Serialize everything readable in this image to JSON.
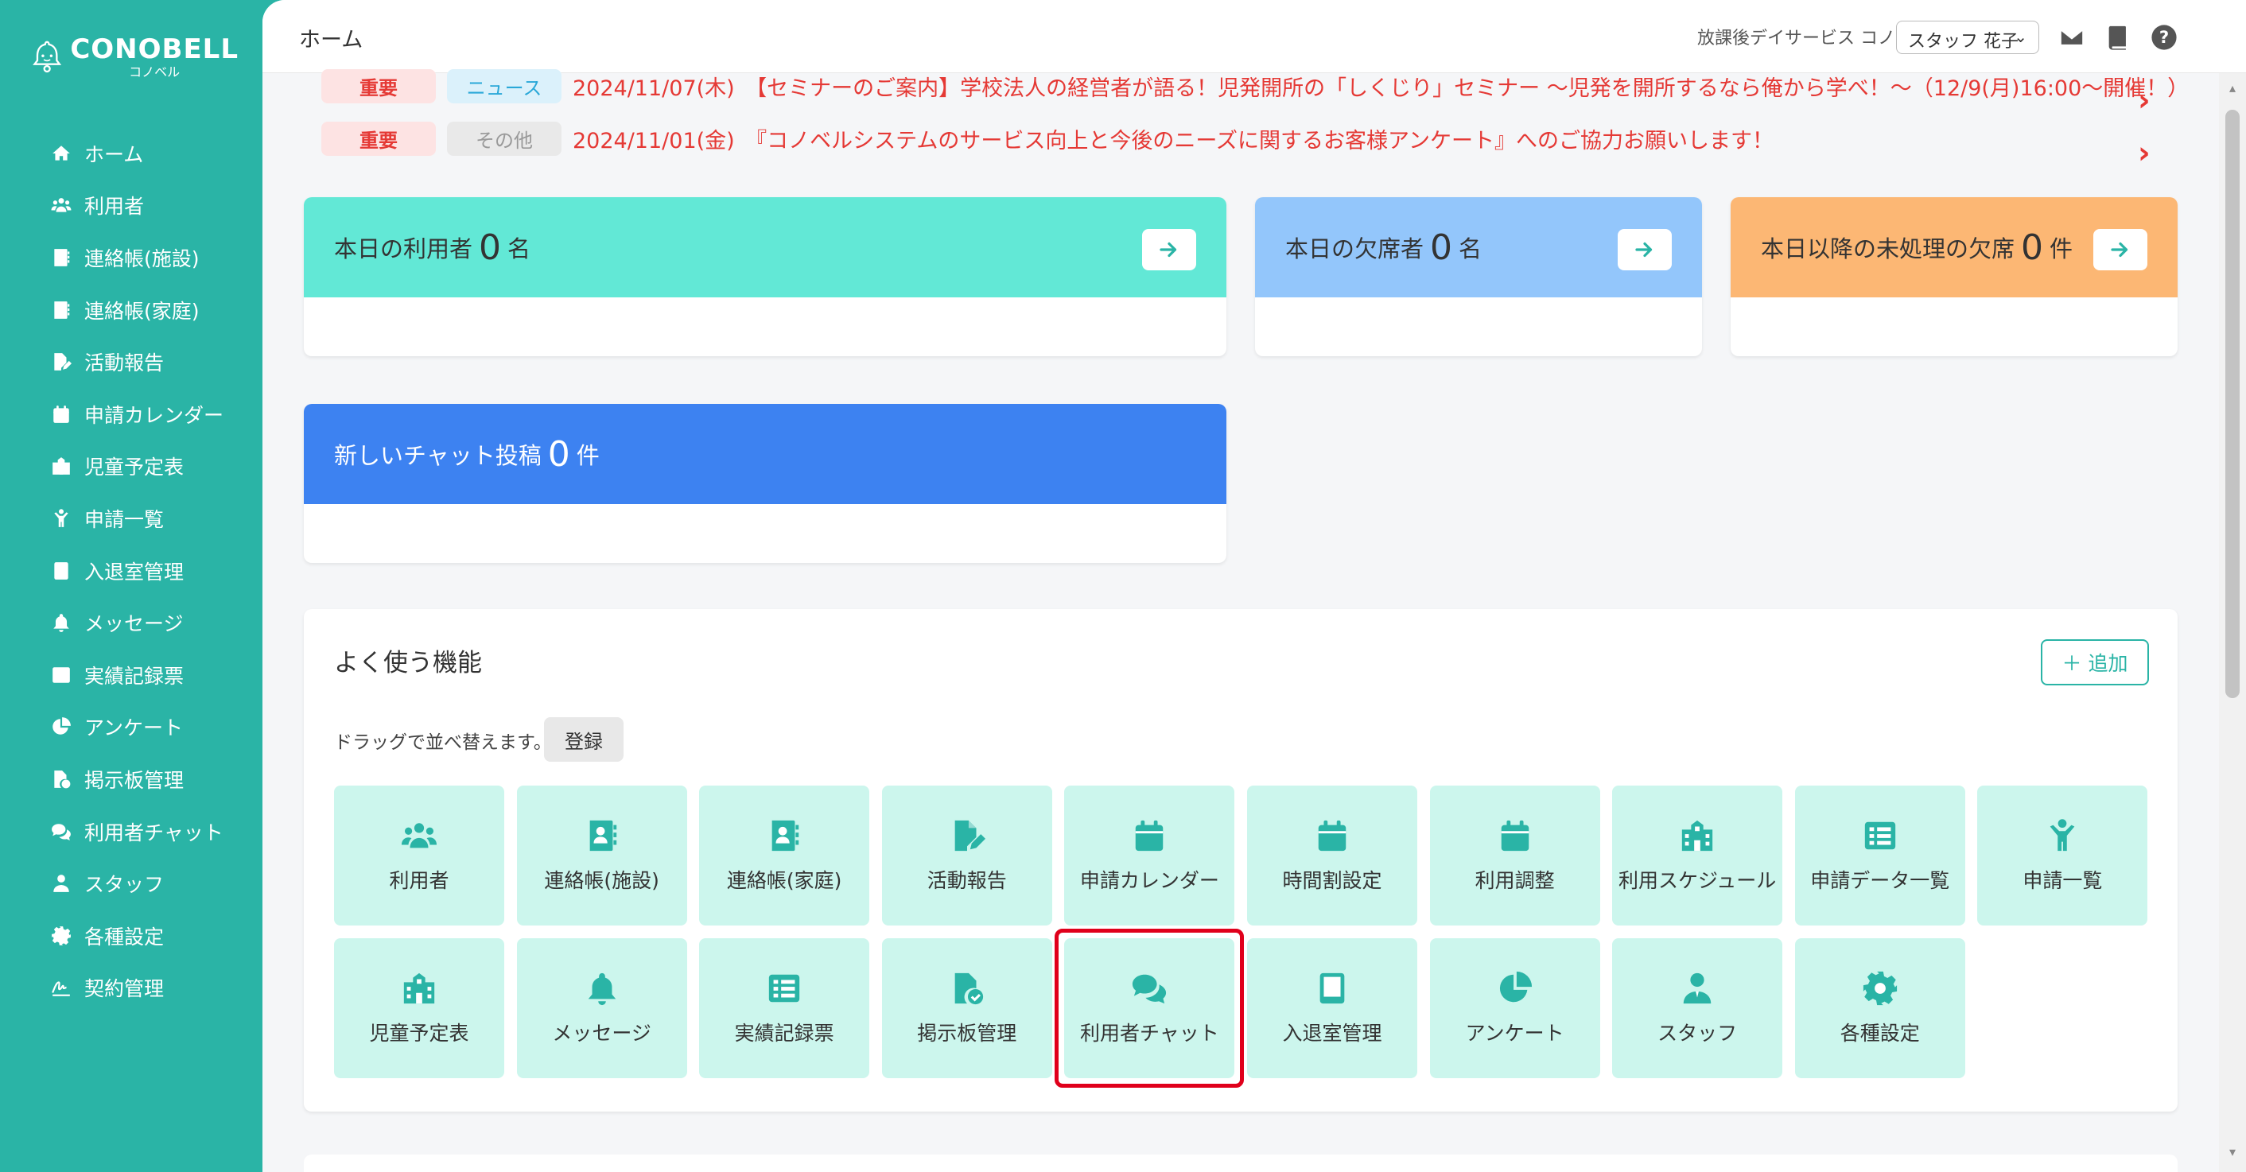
{
  "app": {
    "logo_main": "CONOBELL",
    "logo_sub": "コノベル",
    "page_title": "ホーム",
    "facility": "放課後デイサービス コノベル",
    "staff_name": "スタッフ 花子"
  },
  "colors": {
    "brand": "#2ab4a6",
    "tile_bg": "#ccf6ed",
    "card_green": "#62e8d6",
    "card_blue": "#93c6fb",
    "card_orange": "#fcb774",
    "card_chat": "#3d82f1",
    "alert_red": "#e53935",
    "highlight": "#e0001b"
  },
  "sidebar": {
    "items": [
      {
        "label": "ホーム",
        "icon": "home-icon"
      },
      {
        "label": "利用者",
        "icon": "users-icon"
      },
      {
        "label": "連絡帳(施設)",
        "icon": "contact-book-icon"
      },
      {
        "label": "連絡帳(家庭)",
        "icon": "contact-book-icon"
      },
      {
        "label": "活動報告",
        "icon": "report-edit-icon"
      },
      {
        "label": "申請カレンダー",
        "icon": "calendar-icon"
      },
      {
        "label": "児童予定表",
        "icon": "school-icon"
      },
      {
        "label": "申請一覧",
        "icon": "child-icon"
      },
      {
        "label": "入退室管理",
        "icon": "tablet-icon"
      },
      {
        "label": "メッセージ",
        "icon": "bell-icon"
      },
      {
        "label": "実績記録票",
        "icon": "table-list-icon"
      },
      {
        "label": "アンケート",
        "icon": "pie-chart-icon"
      },
      {
        "label": "掲示板管理",
        "icon": "file-check-icon"
      },
      {
        "label": "利用者チャット",
        "icon": "chat-icon"
      },
      {
        "label": "スタッフ",
        "icon": "user-icon"
      },
      {
        "label": "各種設定",
        "icon": "gear-icon"
      },
      {
        "label": "契約管理",
        "icon": "signature-icon"
      }
    ]
  },
  "news": [
    {
      "badge": "重要",
      "category": "ニュース",
      "text": "2024/11/07(木)　【セミナーのご案内】学校法人の経営者が語る！児発開所の「しくじり」セミナー ～児発を開所するなら俺から学べ！～（12/9(月)16:00～開催！）"
    },
    {
      "badge": "重要",
      "category": "その他",
      "text": "2024/11/01(金)　『コノベルシステムのサービス向上と今後のニーズに関するお客様アンケート』へのご協力お願いします！"
    }
  ],
  "cards": {
    "today_users": {
      "prefix": "本日の利用者",
      "count": "0",
      "unit": "名"
    },
    "today_absent": {
      "prefix": "本日の欠席者",
      "count": "0",
      "unit": "名"
    },
    "unprocessed_absent": {
      "prefix": "本日以降の未処理の欠席",
      "count": "0",
      "unit": "件"
    },
    "new_chat": {
      "prefix": "新しいチャット投稿",
      "count": "0",
      "unit": "件"
    }
  },
  "frequent": {
    "title": "よく使う機能",
    "add_label": "＋ 追加",
    "drag_note": "ドラッグで並べ替えます。",
    "register_label": "登録",
    "tiles": [
      {
        "label": "利用者",
        "icon": "users-icon"
      },
      {
        "label": "連絡帳(施設)",
        "icon": "contact-book-icon"
      },
      {
        "label": "連絡帳(家庭)",
        "icon": "contact-book-icon"
      },
      {
        "label": "活動報告",
        "icon": "report-edit-icon"
      },
      {
        "label": "申請カレンダー",
        "icon": "calendar-icon"
      },
      {
        "label": "時間割設定",
        "icon": "calendar-icon"
      },
      {
        "label": "利用調整",
        "icon": "calendar-icon"
      },
      {
        "label": "利用スケジュール",
        "icon": "school-icon"
      },
      {
        "label": "申請データ一覧",
        "icon": "table-list-icon"
      },
      {
        "label": "申請一覧",
        "icon": "child-icon"
      },
      {
        "label": "児童予定表",
        "icon": "school-icon"
      },
      {
        "label": "メッセージ",
        "icon": "bell-icon"
      },
      {
        "label": "実績記録票",
        "icon": "table-list-icon"
      },
      {
        "label": "掲示板管理",
        "icon": "file-check-icon"
      },
      {
        "label": "利用者チャット",
        "icon": "chat-icon"
      },
      {
        "label": "入退室管理",
        "icon": "tablet-icon"
      },
      {
        "label": "アンケート",
        "icon": "pie-chart-icon"
      },
      {
        "label": "スタッフ",
        "icon": "user-icon"
      },
      {
        "label": "各種設定",
        "icon": "gear-icon"
      }
    ]
  }
}
